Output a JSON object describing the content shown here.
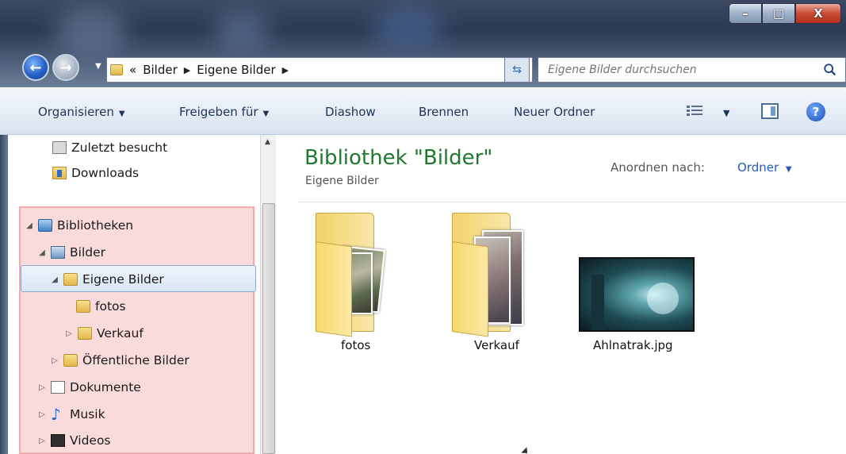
{
  "window": {
    "controls": {
      "minimize": "–",
      "maximize": "□",
      "close": "X"
    }
  },
  "nav": {
    "back_glyph": "←",
    "forward_glyph": "→",
    "breadcrumb": {
      "overflow": "«",
      "items": [
        "Bilder",
        "Eigene Bilder"
      ],
      "sep": "▶"
    },
    "search": {
      "placeholder": "Eigene Bilder durchsuchen"
    }
  },
  "toolbar": {
    "organize": "Organisieren",
    "share": "Freigeben für",
    "slideshow": "Diashow",
    "burn": "Brennen",
    "new_folder": "Neuer Ordner",
    "arrow": "▼",
    "help": "?"
  },
  "sidebar": {
    "items": [
      {
        "label": "Zuletzt besucht"
      },
      {
        "label": "Downloads"
      },
      {
        "label": "Bibliotheken",
        "tri": "◢"
      },
      {
        "label": "Bilder",
        "tri": "◢"
      },
      {
        "label": "Eigene Bilder",
        "tri": "◢"
      },
      {
        "label": "fotos"
      },
      {
        "label": "Verkauf",
        "tri": "▷"
      },
      {
        "label": "Öffentliche Bilder",
        "tri": "▷"
      },
      {
        "label": "Dokumente",
        "tri": "▷"
      },
      {
        "label": "Musik",
        "tri": "▷"
      },
      {
        "label": "Videos",
        "tri": "▷"
      }
    ],
    "scroll_up": "▲"
  },
  "main": {
    "title": "Bibliothek \"Bilder\"",
    "subtitle": "Eigene Bilder",
    "arrange_label": "Anordnen nach:",
    "arrange_value": "Ordner",
    "arrange_arrow": "▼",
    "items": [
      {
        "label": "fotos"
      },
      {
        "label": "Verkauf"
      },
      {
        "label": "Ahlnatrak.jpg"
      }
    ]
  },
  "colors": {
    "title_green": "#1e7a2e",
    "link_blue": "#1f5db8",
    "highlight_pink": "#f2aaaa"
  }
}
